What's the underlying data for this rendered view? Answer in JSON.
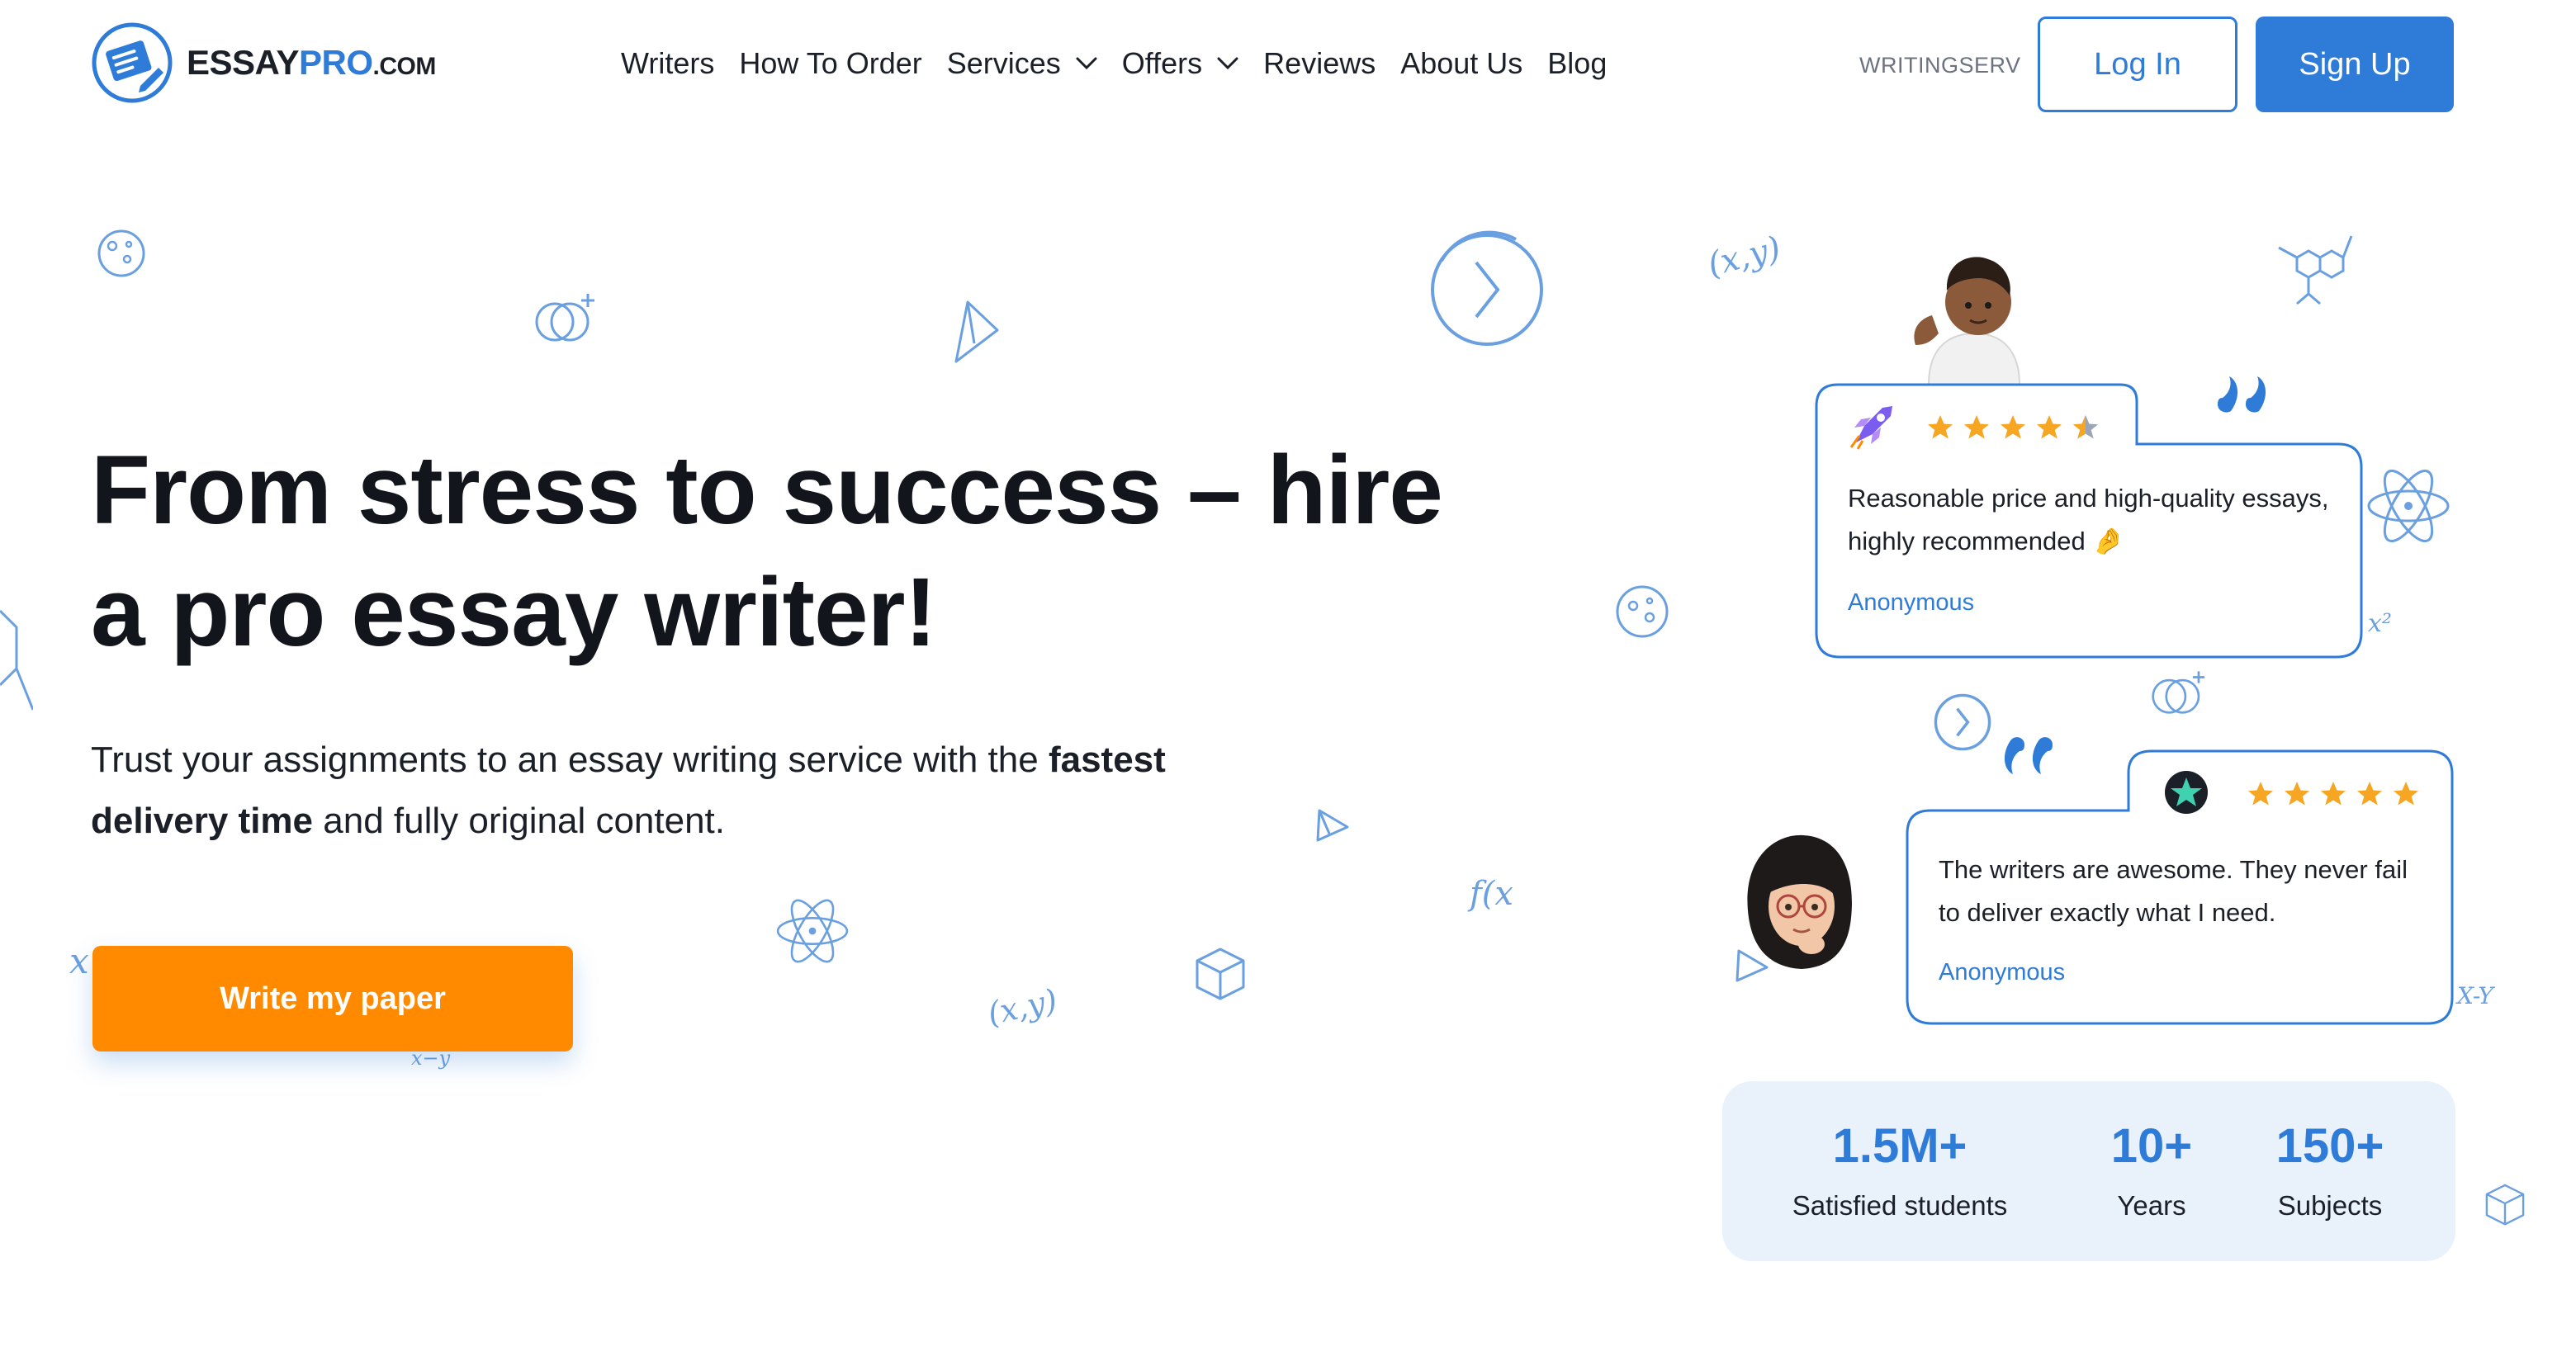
{
  "brand": {
    "name_prefix": "ESSAY",
    "name_highlight": "PRO",
    "name_suffix": ".COM",
    "logo_icon": "notebook-pen-icon",
    "accent_color": "#2f7bd8",
    "cta_color": "#ff8a00"
  },
  "nav": {
    "items": [
      {
        "label": "Writers",
        "has_dropdown": false
      },
      {
        "label": "How To Order",
        "has_dropdown": false
      },
      {
        "label": "Services",
        "has_dropdown": true
      },
      {
        "label": "Offers",
        "has_dropdown": true
      },
      {
        "label": "Reviews",
        "has_dropdown": false
      },
      {
        "label": "About Us",
        "has_dropdown": false
      },
      {
        "label": "Blog",
        "has_dropdown": false
      }
    ],
    "promo_code": "WRITINGSERV",
    "login_label": "Log In",
    "signup_label": "Sign Up"
  },
  "hero": {
    "title": "From stress to success – hire a pro essay writer!",
    "subtitle_before": "Trust your assignments to an essay writing service with the ",
    "subtitle_bold": "fastest delivery time",
    "subtitle_after": " and fully original content.",
    "cta_label": "Write my paper"
  },
  "reviews": [
    {
      "rating": 4.5,
      "text": "Reasonable price and high-quality essays, highly recommended 🤌",
      "author": "Anonymous",
      "badge_icon": "rocket-icon"
    },
    {
      "rating": 5,
      "text": "The writers are awesome. They never fail to deliver exactly what I need.",
      "author": "Anonymous",
      "badge_icon": "star-badge-icon"
    }
  ],
  "stats": [
    {
      "value": "1.5M+",
      "label": "Satisfied students"
    },
    {
      "value": "10+",
      "label": "Years"
    },
    {
      "value": "150+",
      "label": "Subjects"
    }
  ],
  "doodles": {
    "xy_label": "(x,y)",
    "fx_label": "f(x",
    "x2_label": "x²",
    "xminusy_label": "x−y",
    "xy_alt_label": "X-Y"
  }
}
